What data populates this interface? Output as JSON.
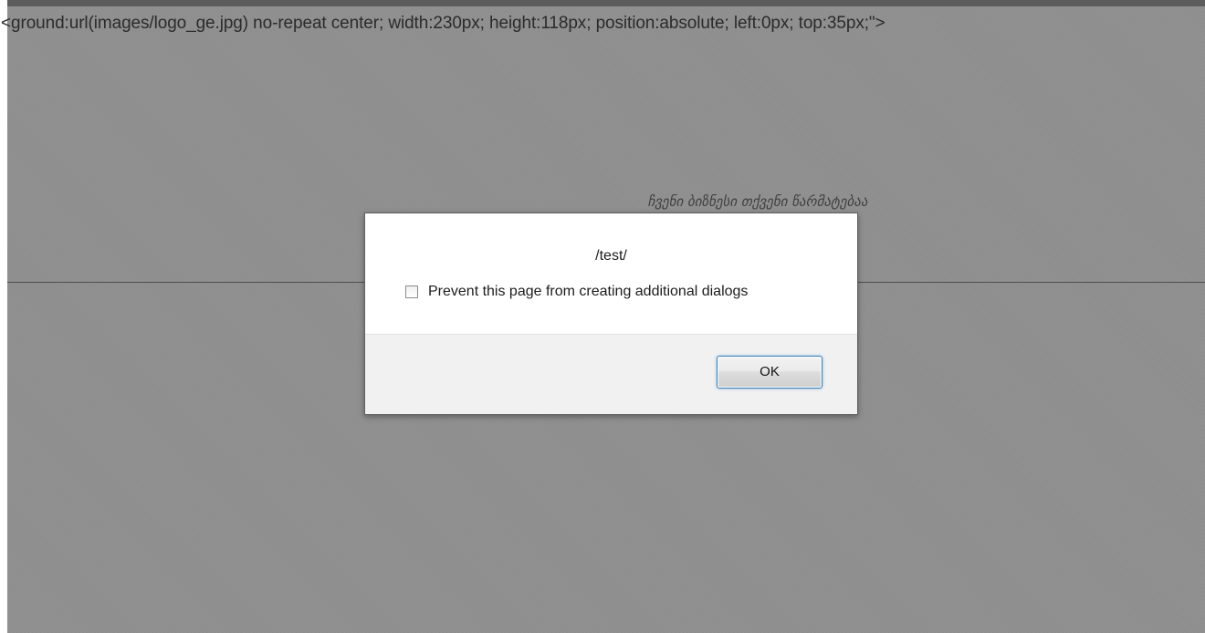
{
  "page": {
    "leaked_code_text": "<ground:url(images/logo_ge.jpg) no-repeat center; width:230px; height:118px; position:absolute; left:0px; top:35px;\">",
    "tagline": "ჩვენი ბიზნესი თქვენი წარმატებაა"
  },
  "dialog": {
    "message": "/test/",
    "suppress_checkbox_label": "Prevent this page from creating additional dialogs",
    "suppress_checked": false,
    "ok_label": "OK"
  },
  "colors": {
    "overlay": "#8e8e8f",
    "dialog_background": "#ffffff",
    "dialog_footer": "#f1f1f1",
    "button_focus_border": "#3c7fb1"
  }
}
